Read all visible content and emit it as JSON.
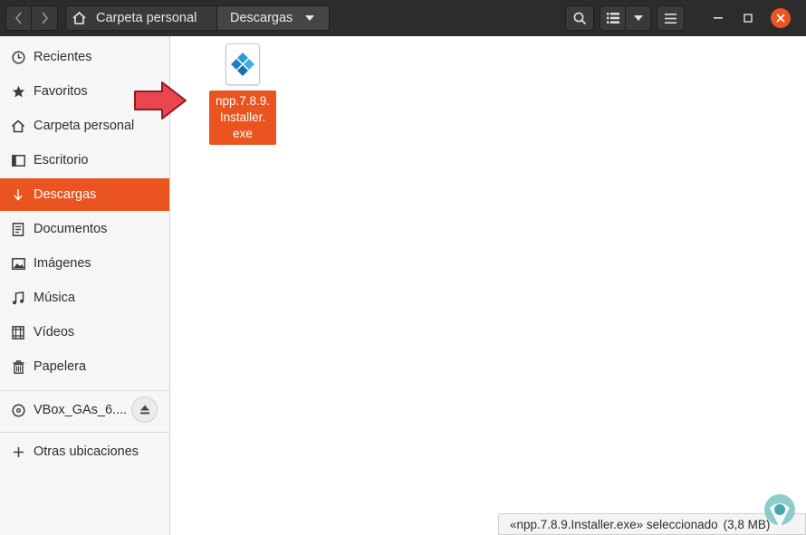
{
  "header": {
    "breadcrumbs": [
      {
        "label": "Carpeta personal",
        "icon": "home-icon"
      },
      {
        "label": "Descargas",
        "icon": "chevron-down-icon"
      }
    ]
  },
  "sidebar": {
    "items": [
      {
        "label": "Recientes",
        "icon": "clock-icon"
      },
      {
        "label": "Favoritos",
        "icon": "star-icon"
      },
      {
        "label": "Carpeta personal",
        "icon": "home-icon"
      },
      {
        "label": "Escritorio",
        "icon": "desktop-icon"
      },
      {
        "label": "Descargas",
        "icon": "download-icon",
        "active": true
      },
      {
        "label": "Documentos",
        "icon": "document-icon"
      },
      {
        "label": "Imágenes",
        "icon": "image-icon"
      },
      {
        "label": "Música",
        "icon": "music-icon"
      },
      {
        "label": "Vídeos",
        "icon": "video-icon"
      },
      {
        "label": "Papelera",
        "icon": "trash-icon"
      }
    ],
    "device": {
      "label": "VBox_GAs_6....",
      "icon": "disc-icon",
      "action_icon": "eject-icon"
    },
    "other": {
      "label": "Otras ubicaciones",
      "icon": "plus-icon"
    }
  },
  "files": [
    {
      "name_lines": [
        "npp.7.8.9.",
        "Installer.",
        "exe"
      ],
      "icon": "installer-icon",
      "selected": true
    }
  ],
  "status": {
    "text": "«npp.7.8.9.Installer.exe» seleccionado",
    "size": "(3,8 MB)"
  },
  "colors": {
    "accent": "#e95420",
    "headerbar": "#2c2c2c",
    "sidebar": "#f6f6f6",
    "arrow": "#e8474f"
  }
}
